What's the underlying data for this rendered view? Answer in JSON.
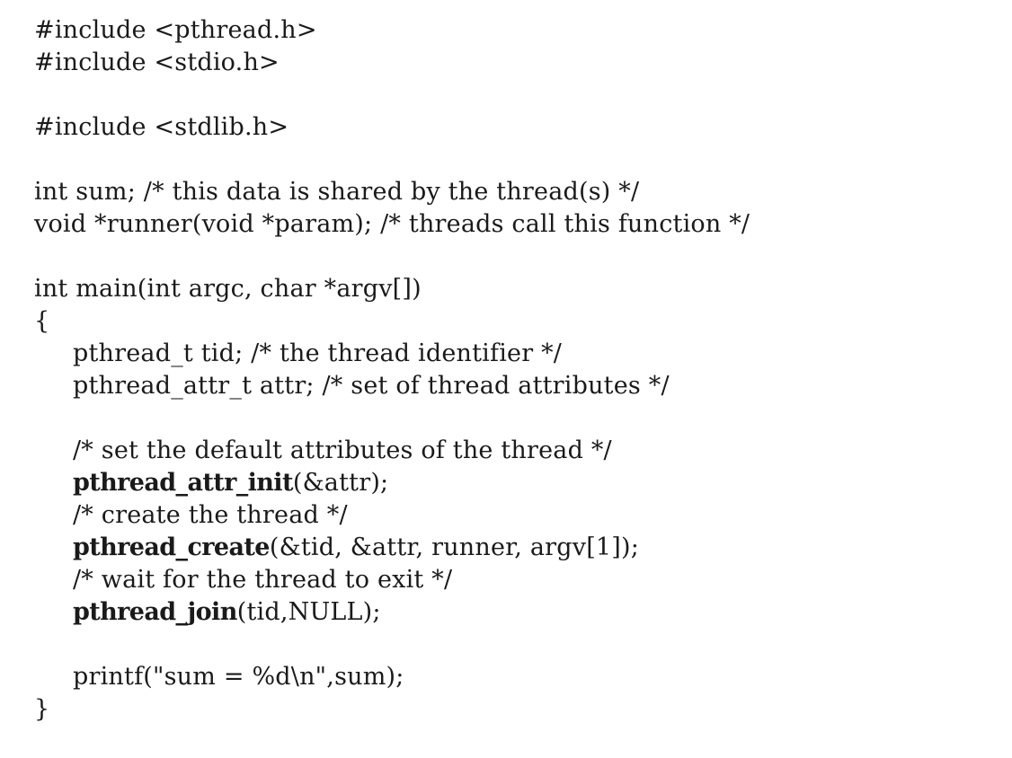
{
  "code": {
    "include_pthread": "#include <pthread.h>",
    "include_stdio": "#include <stdio.h>",
    "include_stdlib": "#include <stdlib.h>",
    "decl_sum": "int sum; /* this data is shared by the thread(s) */",
    "decl_runner": "void *runner(void *param); /* threads call this function */",
    "main_signature": "int main(int argc, char *argv[])",
    "open_brace": "{",
    "decl_tid": "pthread_t tid; /* the thread identifier */",
    "decl_attr": "pthread_attr_t attr; /* set of thread attributes */",
    "comment_defaults": "/* set the default attributes of the thread */",
    "attr_init_fn": "pthread_attr_init",
    "attr_init_args": "(&attr);",
    "comment_create": "/* create the thread */",
    "create_fn": "pthread_create",
    "create_args": "(&tid, &attr, runner, argv[1]);",
    "comment_wait": "/* wait for the thread to exit */",
    "join_fn": "pthread_join",
    "join_args": "(tid,NULL);",
    "printf_line": "printf(\"sum = %d\\n\",sum);",
    "close_brace": "}"
  }
}
